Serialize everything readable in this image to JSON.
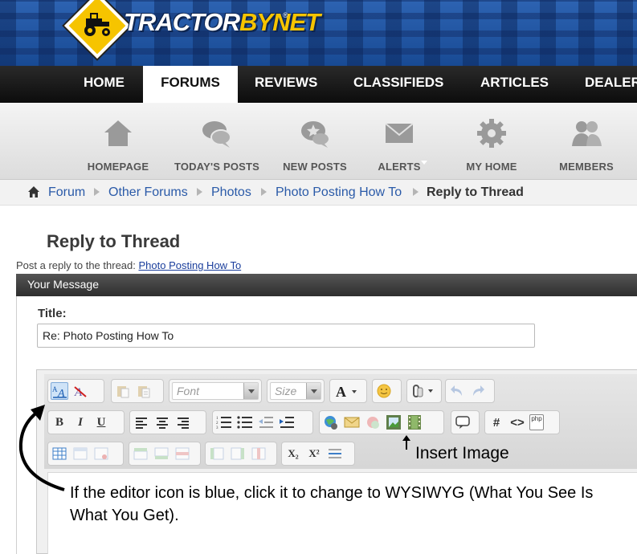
{
  "site": {
    "logo_text_a": "TRACTOR",
    "logo_text_b": "BY",
    "logo_text_c": "NET",
    "logo_reg": "®"
  },
  "colors": {
    "banner_blue": "#1f4f99",
    "logo_yellow": "#f6c400",
    "link_blue": "#2a5aa8",
    "nav_black": "#111111"
  },
  "nav": {
    "items": [
      {
        "label": "HOME",
        "active": false
      },
      {
        "label": "FORUMS",
        "active": true
      },
      {
        "label": "REVIEWS",
        "active": false
      },
      {
        "label": "CLASSIFIEDS",
        "active": false
      },
      {
        "label": "ARTICLES",
        "active": false
      },
      {
        "label": "DEALER",
        "active": false
      }
    ]
  },
  "subnav": {
    "items": [
      {
        "label": "HOMEPAGE",
        "icon": "house-icon"
      },
      {
        "label": "TODAY'S POSTS",
        "icon": "chat-bubbles-icon"
      },
      {
        "label": "NEW POSTS",
        "icon": "star-bubble-icon"
      },
      {
        "label": "ALERTS",
        "icon": "envelope-icon"
      },
      {
        "label": "MY HOME",
        "icon": "gear-icon"
      },
      {
        "label": "MEMBERS",
        "icon": "people-icon"
      }
    ]
  },
  "breadcrumb": {
    "items": [
      "Forum",
      "Other Forums",
      "Photos",
      "Photo Posting How To"
    ],
    "current": "Reply to Thread"
  },
  "page": {
    "title": "Reply to Thread",
    "reply_prefix": "Post a reply to the thread:",
    "reply_thread": "Photo Posting How To"
  },
  "form": {
    "section_header": "Your Message",
    "title_label": "Title:",
    "title_value": "Re: Photo Posting How To"
  },
  "editor": {
    "font_placeholder": "Font",
    "size_placeholder": "Size",
    "bold": "B",
    "italic": "I",
    "underline": "U",
    "hash": "#",
    "code": "<>",
    "php": "php",
    "subscript": "X₂",
    "superscript": "X²"
  },
  "annotation": {
    "insert_image": "Insert Image",
    "note": "If the editor icon is blue, click it to change to WYSIWYG (What You See Is What You Get)."
  }
}
